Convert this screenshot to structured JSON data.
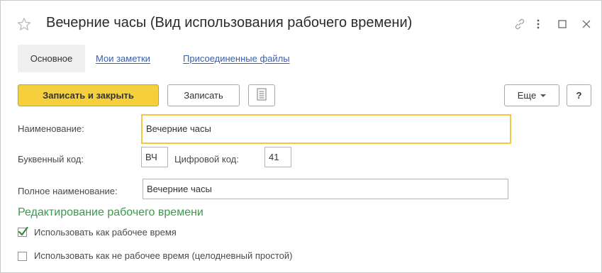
{
  "window": {
    "title": "Вечерние часы (Вид использования рабочего времени)"
  },
  "tabs": [
    {
      "label": "Основное"
    },
    {
      "label": "Мои заметки"
    },
    {
      "label": "Присоединенные файлы"
    }
  ],
  "toolbar": {
    "save_close_label": "Записать и закрыть",
    "save_label": "Записать",
    "more_label": "Еще",
    "help_label": "?"
  },
  "form": {
    "name_label": "Наименование:",
    "name_value": "Вечерние часы",
    "letter_code_label": "Буквенный код:",
    "letter_code_value": "ВЧ",
    "digit_code_label": "Цифровой код:",
    "digit_code_value": "41",
    "full_name_label": "Полное наименование:",
    "full_name_value": "Вечерние часы"
  },
  "section": {
    "title": "Редактирование рабочего времени",
    "options": [
      {
        "label": "Использовать как рабочее время",
        "checked": true
      },
      {
        "label": "Использовать как не рабочее время (целодневный простой)",
        "checked": false
      }
    ]
  },
  "colors": {
    "primary_button": "#f6d03c",
    "link": "#3a5ea8",
    "section_title": "#3a9a4a",
    "focus_border": "#f4c742",
    "checkmark": "#2f8a3a"
  },
  "icons": [
    "star-icon",
    "link-icon",
    "more-vertical-icon",
    "maximize-icon",
    "close-icon",
    "document-list-icon",
    "chevron-down-icon",
    "checkmark-icon"
  ]
}
